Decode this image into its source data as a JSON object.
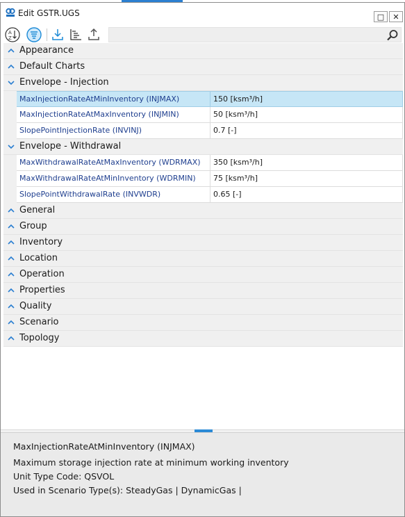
{
  "window": {
    "title": "Edit GSTR.UGS",
    "maximize_glyph": "□",
    "close_glyph": "✕"
  },
  "toolbar": {
    "buttons": [
      "sort-alphabetical-icon",
      "categorized-view-icon",
      "import-icon",
      "tree-icon",
      "export-icon"
    ],
    "search_placeholder": ""
  },
  "grid": {
    "categories": [
      {
        "label": "Appearance",
        "expanded": false
      },
      {
        "label": "Default Charts",
        "expanded": false
      },
      {
        "label": "Envelope - Injection",
        "expanded": true,
        "properties": [
          {
            "name": "MaxInjectionRateAtMinInventory (INJMAX)",
            "value": "150 [ksm³/h]",
            "selected": true
          },
          {
            "name": "MaxInjectionRateAtMaxInventory (INJMIN)",
            "value": "50 [ksm³/h]"
          },
          {
            "name": "SlopePointInjectionRate (INVINJ)",
            "value": "0.7 [-]"
          }
        ]
      },
      {
        "label": "Envelope - Withdrawal",
        "expanded": true,
        "properties": [
          {
            "name": "MaxWithdrawalRateAtMaxInventory (WDRMAX)",
            "value": "350 [ksm³/h]"
          },
          {
            "name": "MaxWithdrawalRateAtMinInventory (WDRMIN)",
            "value": "75 [ksm³/h]"
          },
          {
            "name": "SlopePointWithdrawalRate (INVWDR)",
            "value": "0.65 [-]"
          }
        ]
      },
      {
        "label": "General",
        "expanded": false
      },
      {
        "label": "Group",
        "expanded": false
      },
      {
        "label": "Inventory",
        "expanded": false
      },
      {
        "label": "Location",
        "expanded": false
      },
      {
        "label": "Operation",
        "expanded": false
      },
      {
        "label": "Properties",
        "expanded": false
      },
      {
        "label": "Quality",
        "expanded": false
      },
      {
        "label": "Scenario",
        "expanded": false
      },
      {
        "label": "Topology",
        "expanded": false
      }
    ]
  },
  "description": {
    "title": "MaxInjectionRateAtMinInventory  (INJMAX)",
    "text": "Maximum storage injection rate at minimum working inventory",
    "unit_type": "Unit Type Code: QSVOL",
    "scenario_types": "Used in Scenario Type(s): SteadyGas | DynamicGas |"
  },
  "colors": {
    "accent": "#2b7fd1",
    "selection": "#c6e6f6",
    "category_bg": "#f0f0f0",
    "property_name": "#1f3f8f"
  }
}
